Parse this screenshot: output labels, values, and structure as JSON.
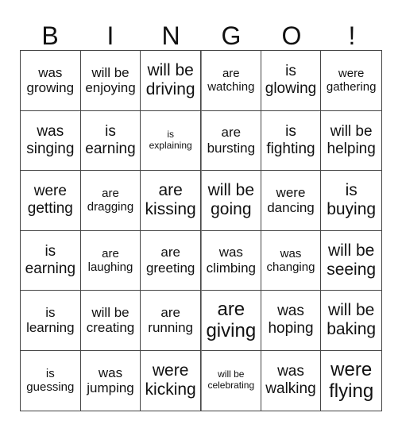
{
  "header": {
    "letters": [
      "B",
      "I",
      "N",
      "G",
      "O",
      "!"
    ]
  },
  "cells": [
    {
      "line1": "was",
      "line2": "growing",
      "size": "md"
    },
    {
      "line1": "will be",
      "line2": "enjoying",
      "size": "md"
    },
    {
      "line1": "will be",
      "line2": "driving",
      "size": "xl"
    },
    {
      "line1": "are",
      "line2": "watching",
      "size": "sm"
    },
    {
      "line1": "is",
      "line2": "glowing",
      "size": "lg"
    },
    {
      "line1": "were",
      "line2": "gathering",
      "size": "sm"
    },
    {
      "line1": "was",
      "line2": "singing",
      "size": "lg"
    },
    {
      "line1": "is",
      "line2": "earning",
      "size": "lg"
    },
    {
      "line1": "is",
      "line2": "explaining",
      "size": "xs"
    },
    {
      "line1": "are",
      "line2": "bursting",
      "size": "md"
    },
    {
      "line1": "is",
      "line2": "fighting",
      "size": "lg"
    },
    {
      "line1": "will be",
      "line2": "helping",
      "size": "lg"
    },
    {
      "line1": "were",
      "line2": "getting",
      "size": "lg"
    },
    {
      "line1": "are",
      "line2": "dragging",
      "size": "sm"
    },
    {
      "line1": "are",
      "line2": "kissing",
      "size": "xl"
    },
    {
      "line1": "will be",
      "line2": "going",
      "size": "xl"
    },
    {
      "line1": "were",
      "line2": "dancing",
      "size": "md"
    },
    {
      "line1": "is",
      "line2": "buying",
      "size": "xl"
    },
    {
      "line1": "is",
      "line2": "earning",
      "size": "lg"
    },
    {
      "line1": "are",
      "line2": "laughing",
      "size": "sm"
    },
    {
      "line1": "are",
      "line2": "greeting",
      "size": "md"
    },
    {
      "line1": "was",
      "line2": "climbing",
      "size": "md"
    },
    {
      "line1": "was",
      "line2": "changing",
      "size": "sm"
    },
    {
      "line1": "will be",
      "line2": "seeing",
      "size": "xl"
    },
    {
      "line1": "is",
      "line2": "learning",
      "size": "md"
    },
    {
      "line1": "will be",
      "line2": "creating",
      "size": "md"
    },
    {
      "line1": "are",
      "line2": "running",
      "size": "md"
    },
    {
      "line1": "are",
      "line2": "giving",
      "size": "xxl"
    },
    {
      "line1": "was",
      "line2": "hoping",
      "size": "lg"
    },
    {
      "line1": "will be",
      "line2": "baking",
      "size": "xl"
    },
    {
      "line1": "is",
      "line2": "guessing",
      "size": "sm"
    },
    {
      "line1": "was",
      "line2": "jumping",
      "size": "md"
    },
    {
      "line1": "were",
      "line2": "kicking",
      "size": "xl"
    },
    {
      "line1": "will be",
      "line2": "celebrating",
      "size": "xs"
    },
    {
      "line1": "was",
      "line2": "walking",
      "size": "lg"
    },
    {
      "line1": "were",
      "line2": "flying",
      "size": "xxl"
    }
  ]
}
